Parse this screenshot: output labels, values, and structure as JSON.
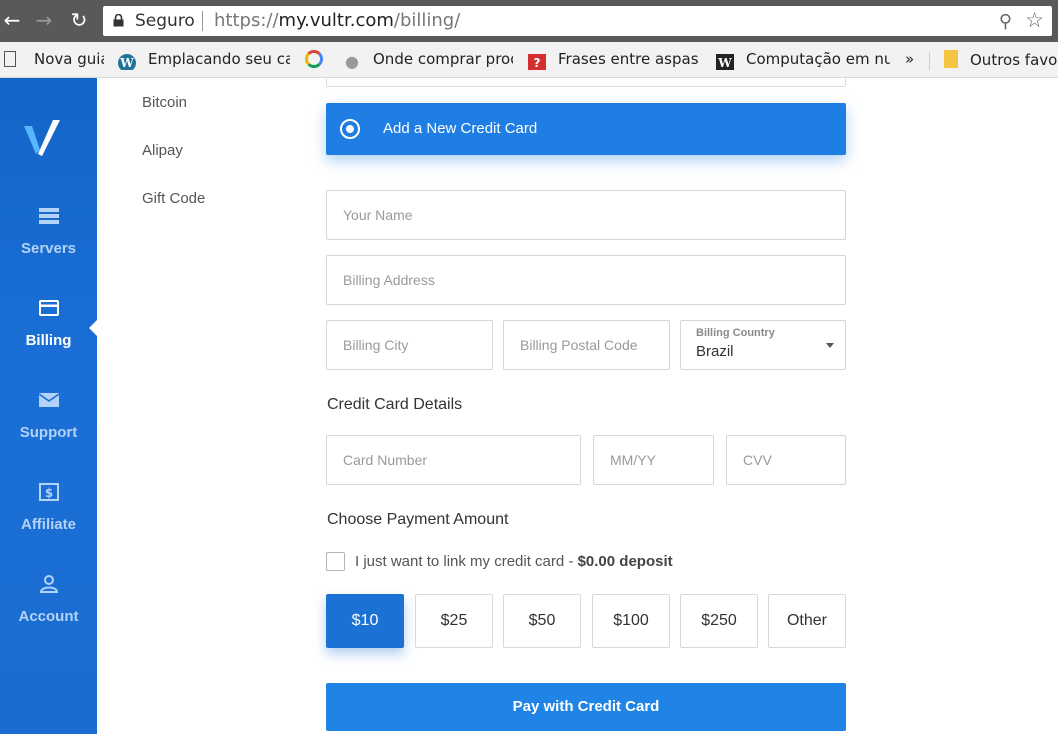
{
  "browser": {
    "secure_label": "Seguro",
    "url_scheme": "https://",
    "url_host": "my.vultr.com",
    "url_path": "/billing/"
  },
  "bookmarks": [
    {
      "label": "Nova guia",
      "icon": "page-icon"
    },
    {
      "label": "Emplacando seu carro",
      "icon": "wordpress-icon"
    },
    {
      "label": "",
      "icon": "google-icon"
    },
    {
      "label": "Onde comprar produtos",
      "icon": "apple-icon"
    },
    {
      "label": "Frases entre aspas: p",
      "icon": "question-icon"
    },
    {
      "label": "Computação em nuvem",
      "icon": "wikipedia-icon"
    },
    {
      "label": "»",
      "icon": ""
    },
    {
      "label": "Outros favoritos",
      "icon": "folder-icon"
    }
  ],
  "sidebar": {
    "items": [
      {
        "label": "Servers",
        "icon": "servers-icon"
      },
      {
        "label": "Billing",
        "icon": "credit-card-icon",
        "active": true
      },
      {
        "label": "Support",
        "icon": "envelope-icon"
      },
      {
        "label": "Affiliate",
        "icon": "dollar-icon"
      },
      {
        "label": "Account",
        "icon": "user-icon"
      }
    ]
  },
  "submenu": [
    "Bitcoin",
    "Alipay",
    "Gift Code"
  ],
  "form": {
    "new_card_label": "Add a New Credit Card",
    "name_placeholder": "Your Name",
    "address_placeholder": "Billing Address",
    "city_placeholder": "Billing City",
    "postal_placeholder": "Billing Postal Code",
    "country_caption": "Billing Country",
    "country_value": "Brazil",
    "card_details_heading": "Credit Card Details",
    "card_number_placeholder": "Card Number",
    "expiry_placeholder": "MM/YY",
    "cvv_placeholder": "CVV",
    "amount_heading": "Choose Payment Amount",
    "link_text": "I just want to link my credit card - ",
    "link_deposit": "$0.00 deposit",
    "amounts": [
      "$10",
      "$25",
      "$50",
      "$100",
      "$250",
      "Other"
    ],
    "selected_amount": "$10",
    "pay_button": "Pay with Credit Card"
  },
  "colors": {
    "accent": "#1f7ee3",
    "sidebar": "#1a6fd6"
  }
}
